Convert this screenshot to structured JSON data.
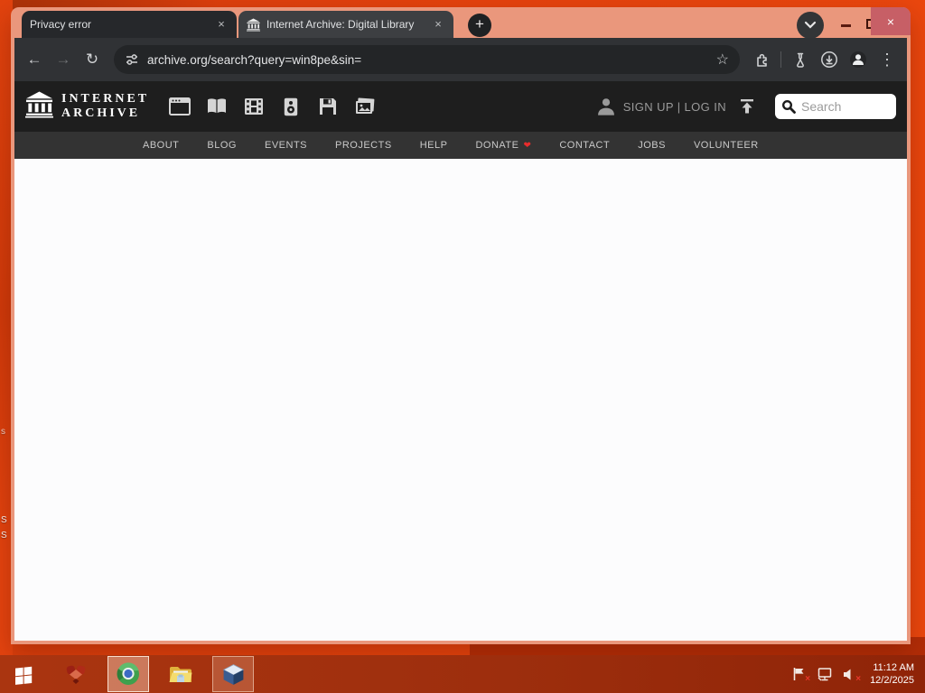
{
  "desktop": {
    "wallpaper_primary": "#e5430d",
    "icon_label_fragments": [
      "S",
      "S",
      "s"
    ]
  },
  "browser": {
    "tabs": [
      {
        "title": "Privacy error",
        "active": false
      },
      {
        "title": "Internet Archive: Digital Library",
        "active": true,
        "favicon": "internet-archive-building"
      }
    ],
    "toolbar": {
      "url": "archive.org/search?query=win8pe&sin="
    },
    "window_controls": [
      "tab-search",
      "minimize",
      "maximize",
      "close"
    ],
    "toolbar_icons": [
      "back",
      "forward",
      "reload",
      "site-settings-tune",
      "bookmark-star",
      "extensions-puzzle",
      "flask",
      "download",
      "profile-avatar",
      "menu-kebab"
    ]
  },
  "icons": {
    "tab_close": "×",
    "new_tab": "+",
    "window_close": "×",
    "back": "←",
    "forward": "→",
    "reload": "↻",
    "bookmark_star": "☆",
    "menu_kebab": "⋮",
    "donate_heart": "❤",
    "tray_error_x": "×"
  },
  "ia": {
    "logo_line1": "INTERNET",
    "logo_line2": "ARCHIVE",
    "media_types": [
      "web",
      "texts",
      "video",
      "audio",
      "software",
      "images"
    ],
    "signup_login": "SIGN UP | LOG IN",
    "search_placeholder": "Search",
    "nav": [
      "ABOUT",
      "BLOG",
      "EVENTS",
      "PROJECTS",
      "HELP",
      "DONATE",
      "CONTACT",
      "JOBS",
      "VOLUNTEER"
    ]
  },
  "taskbar": {
    "apps": [
      "start",
      "red-box-app",
      "chrome",
      "file-explorer",
      "virtualbox"
    ],
    "tray_icons": [
      "action-center-flag",
      "network-monitor",
      "volume-muted"
    ],
    "time": "11:12 AM",
    "date": "12/2/2025"
  },
  "colors": {
    "desktop_orange": "#e5430d",
    "window_frame_salmon": "#ea977c",
    "close_button_rose": "#c75f66",
    "tab_dark": "#26282b",
    "toolbar_dark": "#303235",
    "ia_header": "#1e1e1e",
    "ia_nav": "#333333",
    "taskbar_red": "#9d2e0d",
    "heart_red": "#e82c2c"
  }
}
